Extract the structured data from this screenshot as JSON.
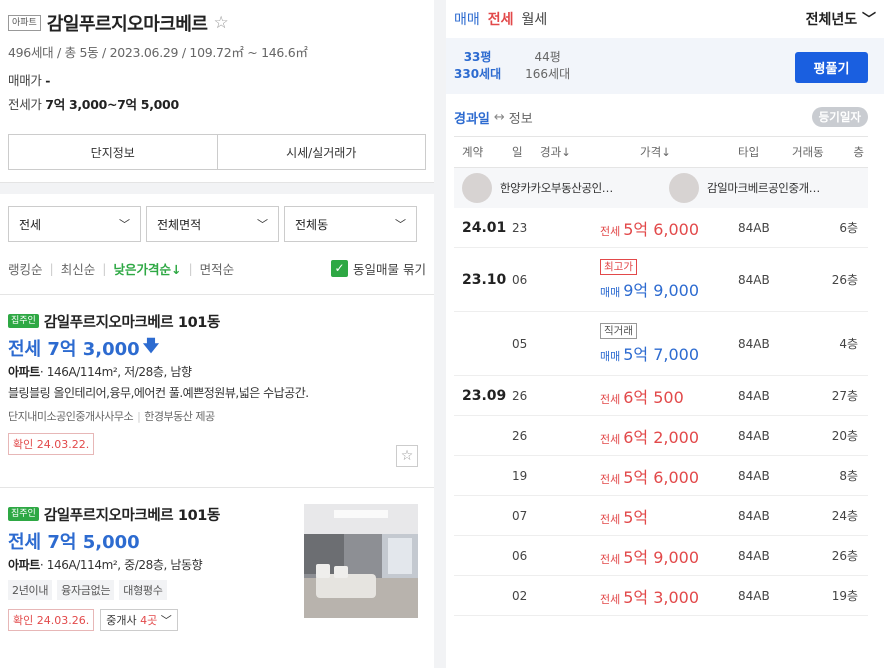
{
  "listing_header": {
    "tag": "아파트",
    "title": "감일푸르지오마크베르",
    "sub_info": "496세대 / 총 5동 / 2023.06.29 / 109.72㎡ ~ 146.6㎡",
    "sale_label": "매매가",
    "sale_value": "-",
    "jeonse_label": "전세가",
    "jeonse_value": "7억 3,000~7억 5,000"
  },
  "detail_tabs": [
    "단지정보",
    "시세/실거래가"
  ],
  "filters": [
    "전세",
    "전체면적",
    "전체동"
  ],
  "sort": {
    "options": [
      "랭킹순",
      "최신순",
      "낮은가격순↓",
      "면적순"
    ],
    "active_index": 2,
    "group_same_label": "동일매물 묶기",
    "group_same_checked": true
  },
  "items": [
    {
      "badge": "집주인",
      "name": "감일푸르지오마크베르 101동",
      "price": "전세 7억 3,000",
      "spec_type": "아파트",
      "spec": "· 146A/114m², 저/28층, 남향",
      "desc": "블링블링 올인테리어,융무,에어컨 풀.예쁜정원뷰,넓은 수납공간.",
      "agent_1": "단지내미소공인중개사사무소",
      "agent_2": "한경부동산 제공",
      "confirm": "확인 24.03.22."
    },
    {
      "badge": "집주인",
      "name": "감일푸르지오마크베르 101동",
      "price": "전세 7억 5,000",
      "spec_type": "아파트",
      "spec": "· 146A/114m², 중/28층, 남동향",
      "tags": [
        "2년이내",
        "융자금없는",
        "대형평수"
      ],
      "confirm": "확인 24.03.26.",
      "agents_label": "중개사",
      "agents_count": "4곳"
    }
  ],
  "trade_tabs": [
    "매매",
    "전세",
    "월세"
  ],
  "year_filter": "전체년도",
  "areas": [
    {
      "size": "33평",
      "units": "330세대",
      "active": true
    },
    {
      "size": "44평",
      "units": "166세대",
      "active": false
    }
  ],
  "pyeong_button": "평풀기",
  "options": {
    "left": "경과일",
    "arrow": "↔",
    "right": "정보",
    "register_button": "등기일자"
  },
  "table_headers": [
    "계약",
    "일",
    "경과↓",
    "가격↓",
    "타입",
    "거래동",
    "층"
  ],
  "agent_offices": [
    "한양카카오부동산공인…",
    "감일마크베르공인중개…"
  ],
  "transactions": [
    {
      "date": "24.01",
      "day": "23",
      "label": "",
      "kind": "전세",
      "price": "5억 6,000",
      "type": "84AB",
      "floor": "6층"
    },
    {
      "date": "23.10",
      "day": "06",
      "label": "최고가",
      "kind": "매매",
      "price": "9억 9,000",
      "type": "84AB",
      "floor": "26층"
    },
    {
      "date": "",
      "day": "05",
      "label": "직거래",
      "kind": "매매",
      "price": "5억 7,000",
      "type": "84AB",
      "floor": "4층"
    },
    {
      "date": "23.09",
      "day": "26",
      "label": "",
      "kind": "전세",
      "price": "6억 500",
      "type": "84AB",
      "floor": "27층"
    },
    {
      "date": "",
      "day": "26",
      "label": "",
      "kind": "전세",
      "price": "6억 2,000",
      "type": "84AB",
      "floor": "20층"
    },
    {
      "date": "",
      "day": "19",
      "label": "",
      "kind": "전세",
      "price": "5억 6,000",
      "type": "84AB",
      "floor": "8층"
    },
    {
      "date": "",
      "day": "07",
      "label": "",
      "kind": "전세",
      "price": "5억",
      "type": "84AB",
      "floor": "24층"
    },
    {
      "date": "",
      "day": "06",
      "label": "",
      "kind": "전세",
      "price": "5억 9,000",
      "type": "84AB",
      "floor": "26층"
    },
    {
      "date": "",
      "day": "02",
      "label": "",
      "kind": "전세",
      "price": "5억 3,000",
      "type": "84AB",
      "floor": "19층"
    }
  ],
  "colors": {
    "jeonse_red": "#e2494a",
    "sale_blue": "#2d6bd0",
    "owner_green": "#2ea844",
    "button_blue": "#1a5fe0"
  }
}
